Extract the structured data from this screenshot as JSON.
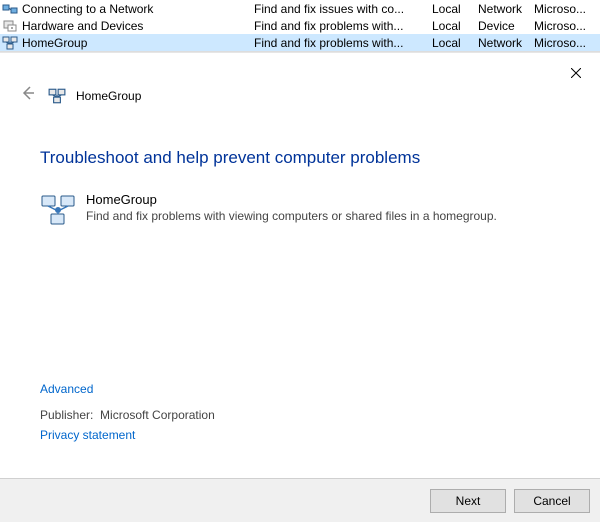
{
  "list": [
    {
      "name": "Connecting to a Network",
      "desc": "Find and fix issues with co...",
      "loc": "Local",
      "cat": "Network",
      "pub": "Microso..."
    },
    {
      "name": "Hardware and Devices",
      "desc": "Find and fix problems with...",
      "loc": "Local",
      "cat": "Device",
      "pub": "Microso..."
    },
    {
      "name": "HomeGroup",
      "desc": "Find and fix problems with...",
      "loc": "Local",
      "cat": "Network",
      "pub": "Microso..."
    }
  ],
  "dialog": {
    "brand": "HomeGroup",
    "title": "Troubleshoot and help prevent computer problems",
    "item_title": "HomeGroup",
    "item_desc": "Find and fix problems with viewing computers or shared files in a homegroup.",
    "advanced": "Advanced",
    "publisher_label": "Publisher:",
    "publisher_value": "Microsoft Corporation",
    "privacy": "Privacy statement",
    "next": "Next",
    "cancel": "Cancel"
  }
}
